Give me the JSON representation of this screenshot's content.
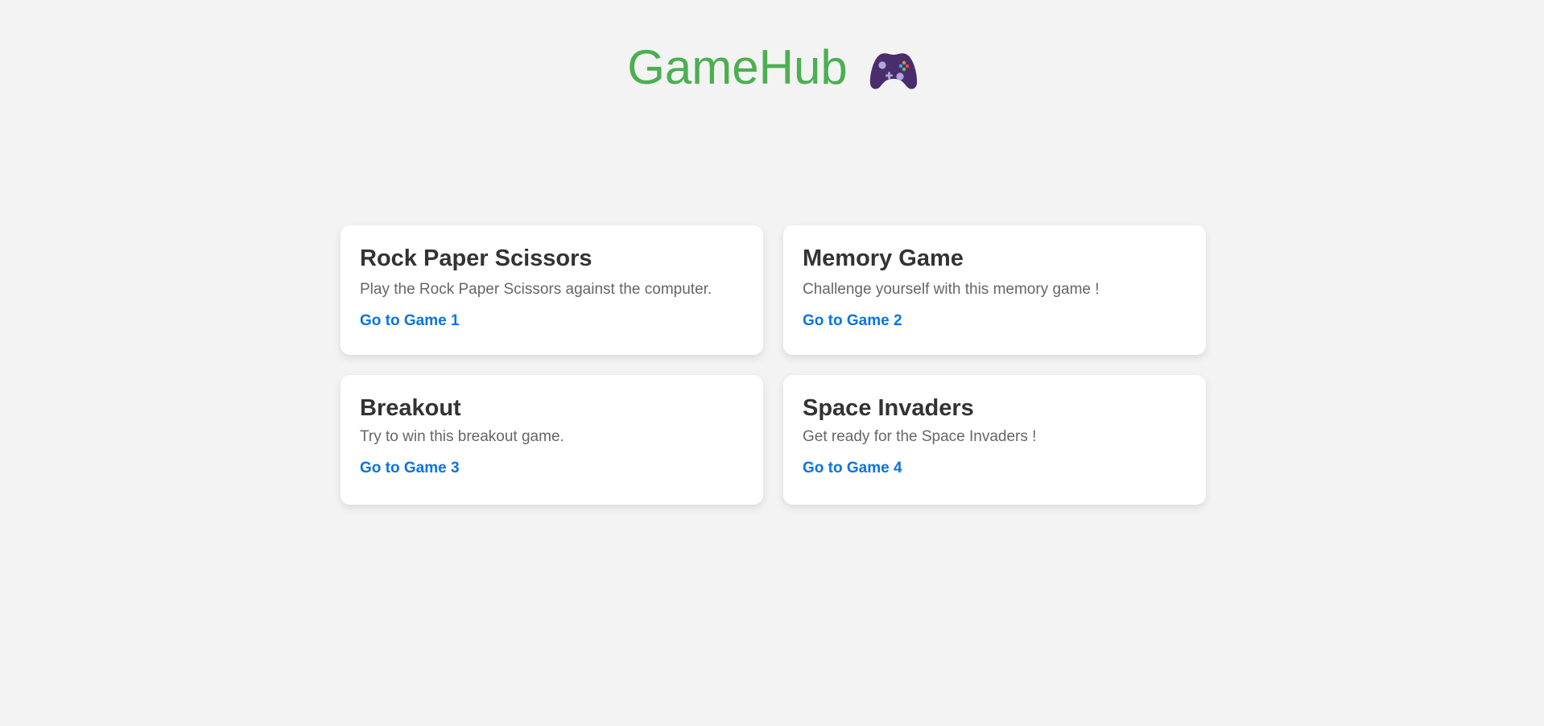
{
  "header": {
    "title": "GameHub",
    "icon": "game-controller-icon"
  },
  "games": [
    {
      "title": "Rock Paper Scissors",
      "description": "Play the Rock Paper Scissors against the computer.",
      "link": "Go to Game 1"
    },
    {
      "title": "Memory Game",
      "description": "Challenge yourself with this memory game !",
      "link": "Go to Game 2"
    },
    {
      "title": "Breakout",
      "description": "Try to win this breakout game.",
      "link": "Go to Game 3"
    },
    {
      "title": "Space Invaders",
      "description": "Get ready for the Space Invaders !",
      "link": "Go to Game 4"
    }
  ],
  "colors": {
    "brand": "#4caf50",
    "link": "#0a74e0",
    "background": "#f3f3f3",
    "card": "#ffffff",
    "controller": "#4a2d6b"
  }
}
